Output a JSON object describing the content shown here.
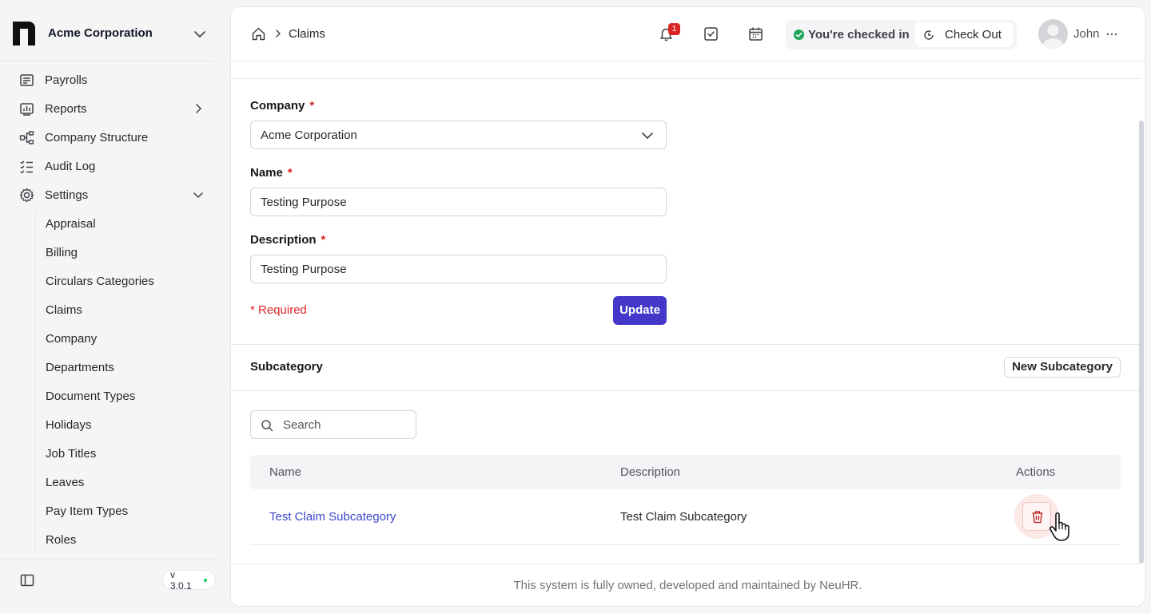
{
  "brand": {
    "name": "Acme Corporation"
  },
  "sidebar": {
    "items": [
      {
        "label": "Payrolls",
        "icon": "payroll-icon"
      },
      {
        "label": "Reports",
        "icon": "reports-icon"
      },
      {
        "label": "Company Structure",
        "icon": "structure-icon"
      },
      {
        "label": "Audit Log",
        "icon": "audit-log-icon"
      },
      {
        "label": "Settings",
        "icon": "gear-icon"
      }
    ],
    "settings_children": [
      "Appraisal",
      "Billing",
      "Circulars Categories",
      "Claims",
      "Company",
      "Departments",
      "Document Types",
      "Holidays",
      "Job Titles",
      "Leaves",
      "Pay Item Types",
      "Roles"
    ],
    "version": "v 3.0.1"
  },
  "topbar": {
    "breadcrumb_current": "Claims",
    "notification_count": "1",
    "checkin_status": "You're checked in",
    "checkout_label": "Check Out",
    "user_name": "John"
  },
  "form": {
    "company_label": "Company",
    "company_value": "Acme Corporation",
    "name_label": "Name",
    "name_value": "Testing Purpose",
    "description_label": "Description",
    "description_value": "Testing Purpose",
    "required_star": "*",
    "required_note": "* Required",
    "update_label": "Update"
  },
  "subcategory": {
    "heading": "Subcategory",
    "new_button": "New Subcategory",
    "search_placeholder": "Search",
    "columns": [
      "Name",
      "Description",
      "Actions"
    ],
    "rows": [
      {
        "name": "Test Claim Subcategory",
        "description": "Test Claim Subcategory"
      }
    ]
  },
  "footer": {
    "text": "This system is fully owned, developed and maintained by NeuHR."
  },
  "colors": {
    "accent": "#4338ca",
    "danger": "#dc2626",
    "success": "#22a55a",
    "link": "#3b48c8"
  }
}
